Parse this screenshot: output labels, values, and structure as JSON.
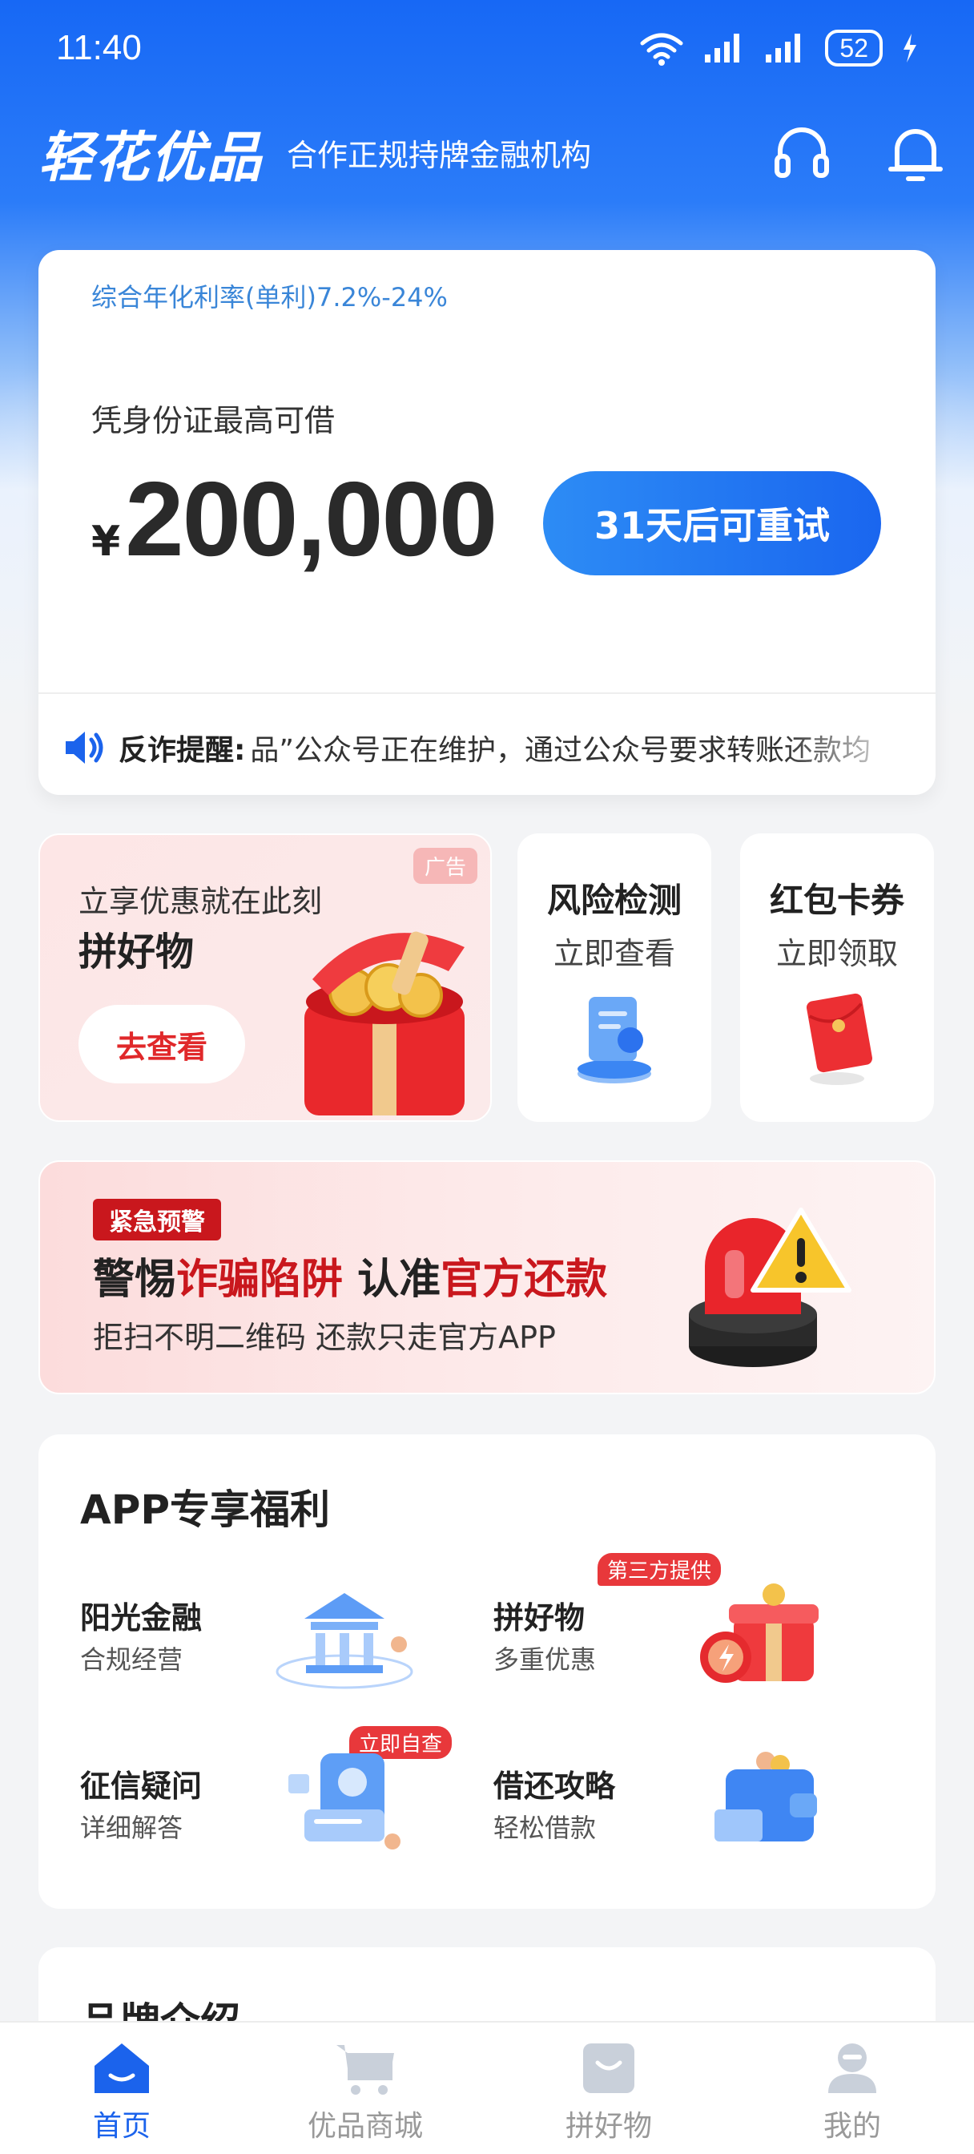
{
  "status_bar": {
    "time": "11:40",
    "battery": "52"
  },
  "header": {
    "brand": "轻花优品",
    "tagline": "合作正规持牌金融机构"
  },
  "loan_card": {
    "rate": "综合年化利率(单利)7.2%-24%",
    "id_text": "凭身份证最高可借",
    "currency": "¥",
    "amount": "200,000",
    "retry_button": "31天后可重试",
    "notice_label": "反诈提醒:",
    "notice_text": "品”公众号正在维护，通过公众号要求转账还款均"
  },
  "promo": {
    "ad_badge": "广告",
    "ad_subtitle": "立享优惠就在此刻",
    "ad_title": "拼好物",
    "ad_button": "去查看",
    "risk": {
      "title": "风险检测",
      "subtitle": "立即查看"
    },
    "coupon": {
      "title": "红包卡券",
      "subtitle": "立即领取"
    }
  },
  "warning": {
    "tag": "紧急预警",
    "title_a": "警惕",
    "title_b": "诈骗陷阱",
    "title_c": " 认准",
    "title_d": "官方还款",
    "subtitle": "拒扫不明二维码 还款只走官方APP"
  },
  "benefits": {
    "title": "APP专享福利",
    "items": [
      {
        "title": "阳光金融",
        "subtitle": "合规经营",
        "tag": ""
      },
      {
        "title": "拼好物",
        "subtitle": "多重优惠",
        "tag": "第三方提供"
      },
      {
        "title": "征信疑问",
        "subtitle": "详细解答",
        "tag": "立即自查"
      },
      {
        "title": "借还攻略",
        "subtitle": "轻松借款",
        "tag": ""
      }
    ]
  },
  "brand_section": {
    "title": "品牌介绍"
  },
  "tabs": [
    {
      "label": "首页",
      "icon": "home-icon"
    },
    {
      "label": "优品商城",
      "icon": "cart-icon"
    },
    {
      "label": "拼好物",
      "icon": "bag-icon"
    },
    {
      "label": "我的",
      "icon": "user-icon"
    }
  ],
  "colors": {
    "primary": "#1b63ec",
    "alert_red": "#c9171d"
  }
}
